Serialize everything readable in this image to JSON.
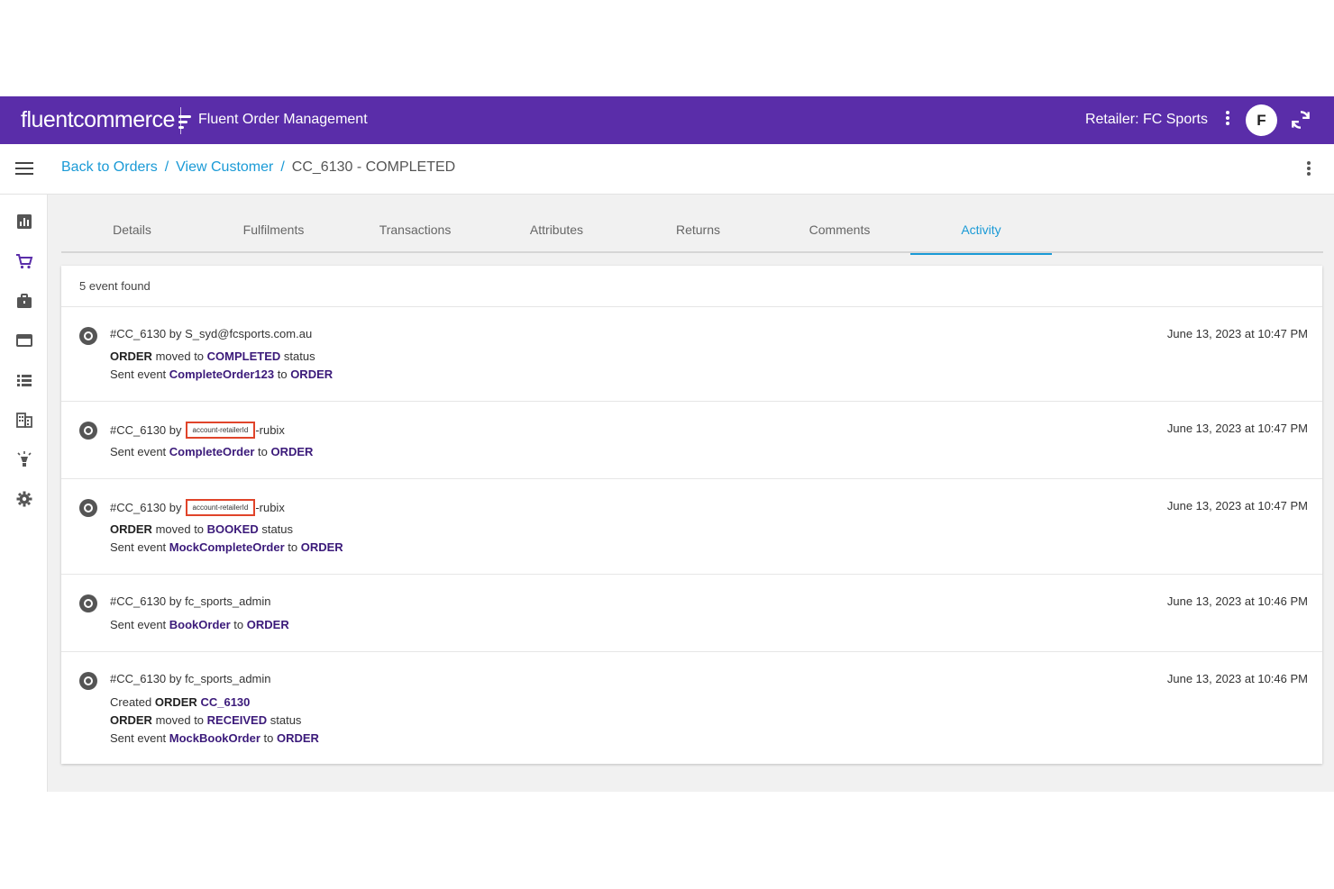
{
  "header": {
    "logo_light": "fluent",
    "logo_bold": "commerce",
    "app_name": "Fluent Order Management",
    "retailer": "Retailer: FC Sports",
    "avatar_letter": "F"
  },
  "breadcrumb": {
    "back_to_orders": "Back to Orders",
    "view_customer": "View Customer",
    "current": "CC_6130 - COMPLETED",
    "separator": "/"
  },
  "tabs": [
    {
      "label": "Details"
    },
    {
      "label": "Fulfilments"
    },
    {
      "label": "Transactions"
    },
    {
      "label": "Attributes"
    },
    {
      "label": "Returns"
    },
    {
      "label": "Comments"
    },
    {
      "label": "Activity",
      "active": true
    }
  ],
  "sidebar_icons": [
    "chart-icon",
    "cart-icon",
    "briefcase-icon",
    "window-icon",
    "list-icon",
    "building-icon",
    "lightbulb-icon",
    "gear-icon"
  ],
  "activity": {
    "count_text": "5 event found",
    "events": [
      {
        "head_pre": "#CC_6130 by S_syd@fcsports.com.au",
        "time": "June 13, 2023 at 10:47 PM",
        "line1": {
          "k": "ORDER",
          "t1": " moved to ",
          "h": "COMPLETED",
          "t2": " status"
        },
        "line2": {
          "t1": "Sent event ",
          "h": "CompleteOrder123",
          "t2": " to ",
          "k": "ORDER"
        }
      },
      {
        "head_pre": "#CC_6130 by",
        "redacted": "account-retailerId",
        "head_post": "-rubix",
        "time": "June 13, 2023 at 10:47 PM",
        "line1": {
          "t1": "Sent event ",
          "h": "CompleteOrder",
          "t2": " to ",
          "k": "ORDER"
        }
      },
      {
        "head_pre": "#CC_6130 by",
        "redacted": "account-retailerId",
        "head_post": "-rubix",
        "time": "June 13, 2023 at 10:47 PM",
        "line1": {
          "k": "ORDER",
          "t1": " moved to ",
          "h": "BOOKED",
          "t2": " status"
        },
        "line2": {
          "t1": "Sent event ",
          "h": "MockCompleteOrder",
          "t2": " to ",
          "k": "ORDER"
        }
      },
      {
        "head_pre": "#CC_6130 by fc_sports_admin",
        "time": "June 13, 2023 at 10:46 PM",
        "line1": {
          "t1": "Sent event ",
          "h": "BookOrder",
          "t2": " to ",
          "k": "ORDER"
        }
      },
      {
        "head_pre": "#CC_6130 by fc_sports_admin",
        "time": "June 13, 2023 at 10:46 PM",
        "line1": {
          "t1": "Created ",
          "k": "ORDER",
          "h": "CC_6130"
        },
        "line2": {
          "k": "ORDER",
          "t1": " moved to ",
          "h": "RECEIVED",
          "t2": " status"
        },
        "line3": {
          "t1": "Sent event ",
          "h": "MockBookOrder",
          "t2": " to ",
          "k": "ORDER"
        }
      }
    ]
  },
  "colors": {
    "topbar": "#5a2da9",
    "link": "#1a9ad6",
    "highlight": "#3b1a7a",
    "redact_border": "#e0442a"
  }
}
